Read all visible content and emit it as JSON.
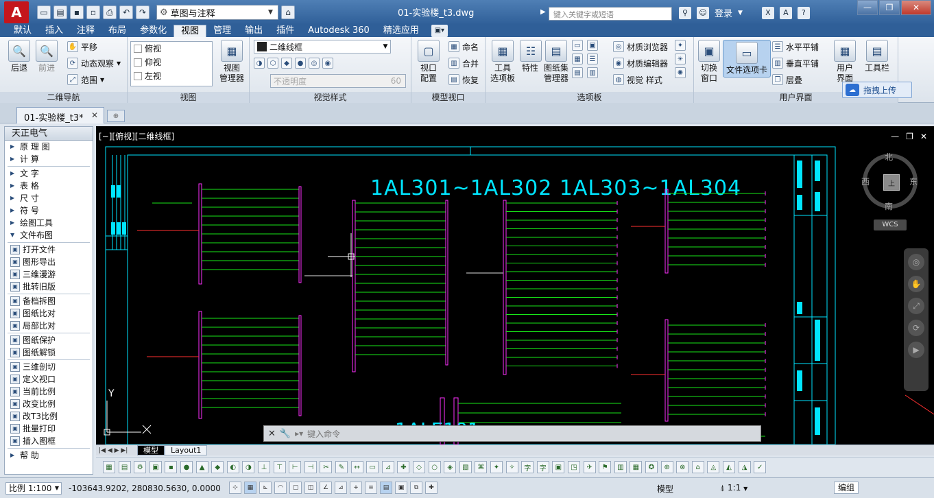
{
  "titlebar": {
    "logo": "A",
    "workspace": "草图与注释",
    "doc_title": "01-实验楼_t3.dwg",
    "search_placeholder": "键入关键字或短语",
    "login": "登录"
  },
  "ribbon_tabs": [
    "默认",
    "插入",
    "注释",
    "布局",
    "参数化",
    "视图",
    "管理",
    "输出",
    "插件",
    "Autodesk 360",
    "精选应用"
  ],
  "active_tab": "视图",
  "panels": {
    "nav2d": {
      "title": "二维导航",
      "back": "后退",
      "forward": "前进",
      "pan": "平移",
      "orbit": "动态观察",
      "extents": "范围"
    },
    "views": {
      "title": "视图",
      "items": [
        "俯视",
        "仰视",
        "左视"
      ],
      "manager": "视图\n管理器"
    },
    "visual_styles": {
      "title": "视觉样式",
      "current": "二维线框",
      "opacity_label": "不透明度",
      "opacity_value": "60"
    },
    "model_viewports": {
      "title": "模型视口",
      "config": "视口\n配置",
      "named": "命名",
      "join": "合并",
      "restore": "恢复"
    },
    "palettes": {
      "title": "选项板",
      "tool_palettes": "工具\n选项板",
      "properties": "特性",
      "sheet_set": "图纸集\n管理器"
    },
    "materials": {
      "browser": "材质浏览器",
      "editor": "材质编辑器",
      "visual_styles": "视觉 样式"
    },
    "ui": {
      "title": "用户界面",
      "switch_windows": "切换\n窗口",
      "file_tabs": "文件选项卡",
      "tile_h": "水平平铺",
      "tile_v": "垂直平铺",
      "cascade": "层叠",
      "user_interface": "用户\n界面",
      "toolbars": "工具栏"
    }
  },
  "upload_label": "拖拽上传",
  "file_tab": "01-实验楼_t3*",
  "palette": {
    "title": "天正电气",
    "groups": [
      [
        {
          "label": "原 理 图",
          "type": "tri"
        },
        {
          "label": "计    算",
          "type": "tri"
        }
      ],
      [
        {
          "label": "文    字",
          "type": "tri"
        },
        {
          "label": "表    格",
          "type": "tri"
        },
        {
          "label": "尺    寸",
          "type": "tri"
        },
        {
          "label": "符    号",
          "type": "tri"
        },
        {
          "label": "绘图工具",
          "type": "tri"
        },
        {
          "label": "文件布图",
          "type": "open"
        }
      ],
      [
        {
          "label": "打开文件",
          "type": "icon"
        },
        {
          "label": "图形导出",
          "type": "icon"
        },
        {
          "label": "三维漫游",
          "type": "icon"
        },
        {
          "label": "批转旧版",
          "type": "icon"
        }
      ],
      [
        {
          "label": "备档拆图",
          "type": "icon"
        },
        {
          "label": "图纸比对",
          "type": "icon"
        },
        {
          "label": "局部比对",
          "type": "icon"
        }
      ],
      [
        {
          "label": "图纸保护",
          "type": "icon"
        },
        {
          "label": "图纸解锁",
          "type": "icon"
        }
      ],
      [
        {
          "label": "三维剖切",
          "type": "icon"
        },
        {
          "label": "定义视口",
          "type": "icon"
        },
        {
          "label": "当前比例",
          "type": "icon"
        },
        {
          "label": "改变比例",
          "type": "icon"
        },
        {
          "label": "改T3比例",
          "type": "icon"
        },
        {
          "label": "批量打印",
          "type": "icon"
        },
        {
          "label": "插入图框",
          "type": "icon"
        }
      ],
      [
        {
          "label": "帮    助",
          "type": "tri"
        }
      ]
    ]
  },
  "drawing": {
    "viewport_label": "[−][俯视][二维线框]",
    "title_main": "1AL301~1AL302  1AL303~1AL304",
    "title_bottom": "1ALE101",
    "viewcube": {
      "north": "北",
      "south": "南",
      "west": "西",
      "east": "东",
      "face": "上"
    },
    "wcs": "WCS",
    "y_axis": "Y"
  },
  "command_line": {
    "placeholder": "键入命令"
  },
  "layout_tabs": [
    "模型",
    "Layout1"
  ],
  "status": {
    "scale": "比例 1:100",
    "coords": "-103643.9202, 280830.5630, 0.0000",
    "model": "模型",
    "annotation_scale": "1:1",
    "edit": "编组"
  },
  "colors": {
    "drawing_bg": "#000000",
    "cad_cyan": "#00e5ff",
    "cad_green": "#18e818",
    "cad_magenta": "#ff30ff",
    "cad_red": "#ff3030",
    "cad_white": "#ffffff",
    "title_blue": "#2f5f98"
  }
}
